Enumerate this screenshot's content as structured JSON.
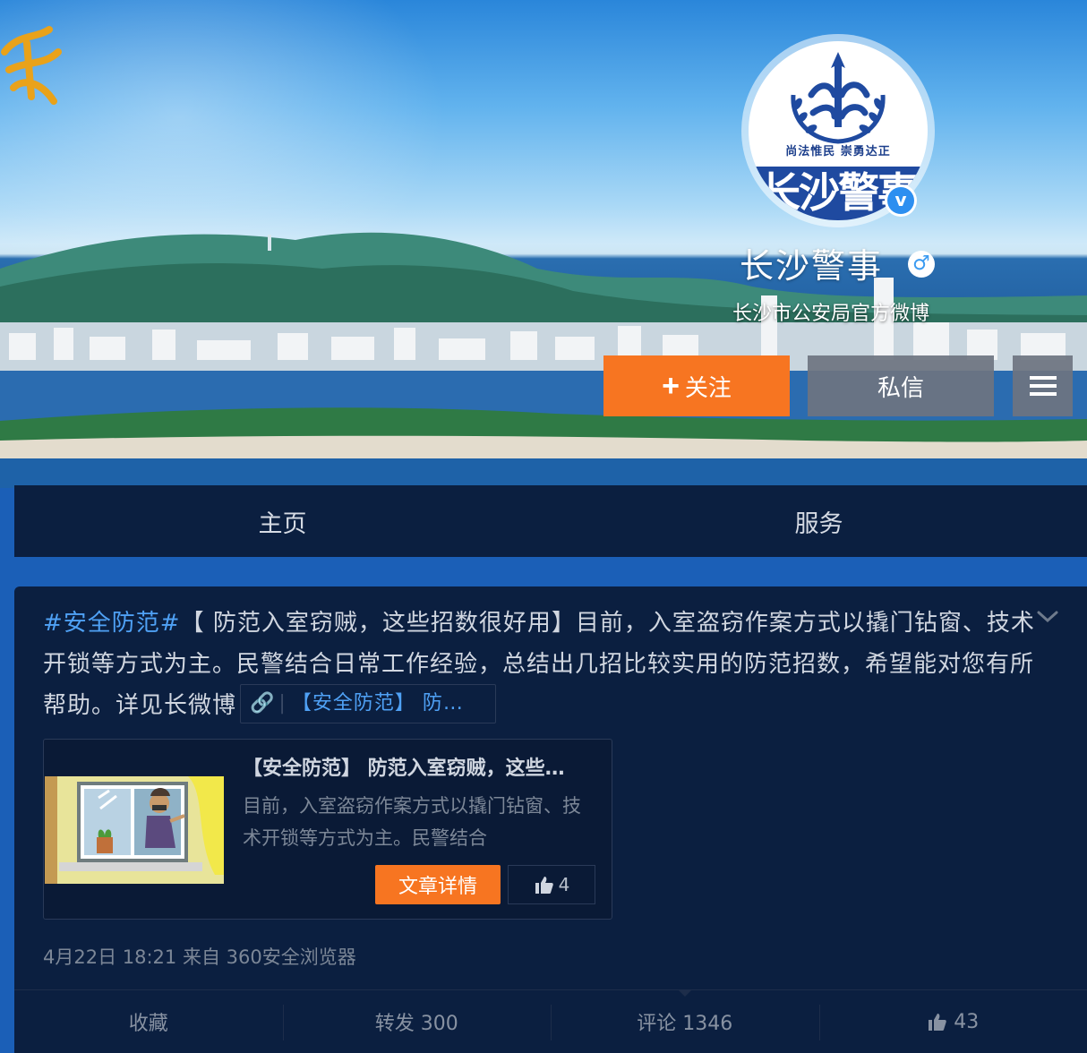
{
  "profile": {
    "name": "长沙警事",
    "description": "长沙市公安局官方微博",
    "avatar_motto": "尚法惟民 崇勇达正",
    "avatar_band_text": "长沙警事",
    "gender_icon": "♂",
    "verified_icon": "v"
  },
  "buttons": {
    "follow_plus": "+",
    "follow_label": "关注",
    "message_label": "私信"
  },
  "nav": {
    "tabs": [
      {
        "label": "主页"
      },
      {
        "label": "服务"
      }
    ]
  },
  "post": {
    "hashtag": "#安全防范#",
    "text": "【 防范入室窃贼，这些招数很好用】目前，入室盗窃作案方式以撬门钻窗、技术开锁等方式为主。民警结合日常工作经验，总结出几招比较实用的防范招数，希望能对您有所帮助。详见长微博",
    "link_chip": "【安全防范】 防…",
    "article": {
      "title": "【安全防范】 防范入室窃贼，这些…",
      "summary": "目前，入室盗窃作案方式以撬门钻窗、技术开锁等方式为主。民警结合",
      "detail_label": "文章详情",
      "like_count": "4"
    },
    "meta": "4月22日 18:21 来自 360安全浏览器",
    "actions": {
      "favorite": "收藏",
      "repost": "转发 300",
      "comment": "评论 1346",
      "like": "43"
    }
  },
  "colors": {
    "accent": "#f77521",
    "link": "#4fa1f5",
    "panel": "#0b1f40"
  },
  "icons": [
    "clip-icon",
    "chevron-down-icon",
    "thumbs-up-icon",
    "menu-icon",
    "plus-icon",
    "gender-male-icon",
    "verified-icon"
  ]
}
